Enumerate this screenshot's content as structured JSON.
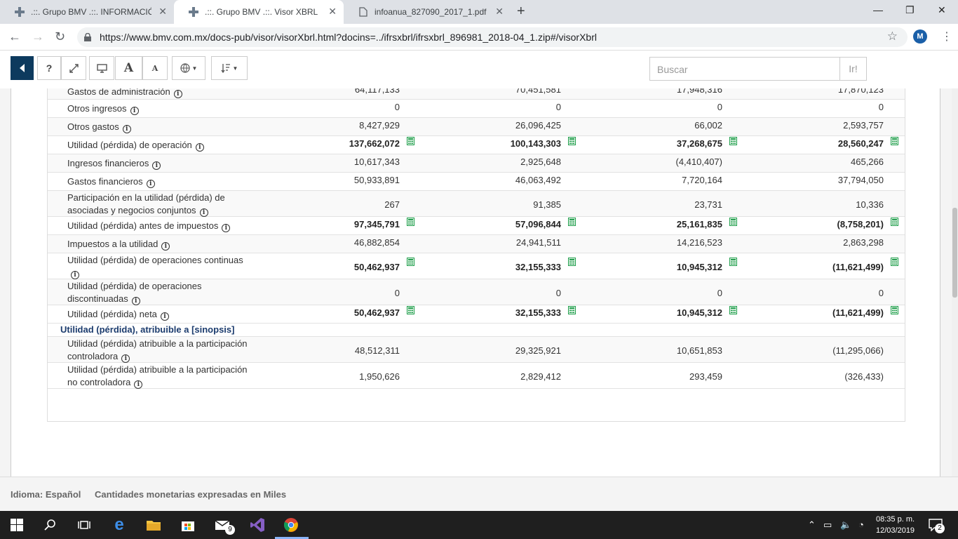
{
  "browser": {
    "tabs": [
      {
        "label": ".::. Grupo BMV .::. INFORMACIÓN",
        "active": false
      },
      {
        "label": ".::. Grupo BMV .::. Visor XBRL",
        "active": true
      },
      {
        "label": "infoanua_827090_2017_1.pdf",
        "active": false
      }
    ],
    "url": "https://www.bmv.com.mx/docs-pub/visor/visorXbrl.html?docins=../ifrsxbrl/ifrsxbrl_896981_2018-04_1.zip#/visorXbrl",
    "profile_initial": "M"
  },
  "toolbar": {
    "help_label": "?",
    "font_large_label": "A",
    "font_small_label": "A",
    "search_placeholder": "Buscar",
    "go_label": "Ir!"
  },
  "table": {
    "rows": [
      {
        "label": "Gastos de administración",
        "values": [
          "64,117,133",
          "70,451,581",
          "17,948,316",
          "17,870,123"
        ],
        "bold": false,
        "calc": false
      },
      {
        "label": "Otros ingresos",
        "values": [
          "0",
          "0",
          "0",
          "0"
        ],
        "bold": false,
        "calc": false
      },
      {
        "label": "Otros gastos",
        "values": [
          "8,427,929",
          "26,096,425",
          "66,002",
          "2,593,757"
        ],
        "bold": false,
        "calc": false
      },
      {
        "label": "Utilidad (pérdida) de operación",
        "values": [
          "137,662,072",
          "100,143,303",
          "37,268,675",
          "28,560,247"
        ],
        "bold": true,
        "calc": true
      },
      {
        "label": "Ingresos financieros",
        "values": [
          "10,617,343",
          "2,925,648",
          "(4,410,407)",
          "465,266"
        ],
        "bold": false,
        "calc": false
      },
      {
        "label": "Gastos financieros",
        "values": [
          "50,933,891",
          "46,063,492",
          "7,720,164",
          "37,794,050"
        ],
        "bold": false,
        "calc": false
      },
      {
        "label": "Participación en la utilidad (pérdida) de asociadas y negocios conjuntos",
        "values": [
          "267",
          "91,385",
          "23,731",
          "10,336"
        ],
        "bold": false,
        "calc": false
      },
      {
        "label": "Utilidad (pérdida) antes de impuestos",
        "values": [
          "97,345,791",
          "57,096,844",
          "25,161,835",
          "(8,758,201)"
        ],
        "bold": true,
        "calc": true
      },
      {
        "label": "Impuestos a la utilidad",
        "values": [
          "46,882,854",
          "24,941,511",
          "14,216,523",
          "2,863,298"
        ],
        "bold": false,
        "calc": false
      },
      {
        "label": "Utilidad (pérdida) de operaciones continuas",
        "values": [
          "50,462,937",
          "32,155,333",
          "10,945,312",
          "(11,621,499)"
        ],
        "bold": true,
        "calc": true
      },
      {
        "label": "Utilidad (pérdida) de operaciones discontinuadas",
        "values": [
          "0",
          "0",
          "0",
          "0"
        ],
        "bold": false,
        "calc": false
      },
      {
        "label": "Utilidad (pérdida) neta",
        "values": [
          "50,462,937",
          "32,155,333",
          "10,945,312",
          "(11,621,499)"
        ],
        "bold": true,
        "calc": true
      },
      {
        "label": "Utilidad (pérdida) atribuible a la participación controladora",
        "values": [
          "48,512,311",
          "29,325,921",
          "10,651,853",
          "(11,295,066)"
        ],
        "bold": false,
        "calc": false
      },
      {
        "label": "Utilidad (pérdida) atribuible a la participación no controladora",
        "values": [
          "1,950,626",
          "2,829,412",
          "293,459",
          "(326,433)"
        ],
        "bold": false,
        "calc": false
      }
    ],
    "section_title": "Utilidad (pérdida), atribuible a [sinopsis]"
  },
  "footer": {
    "language": "Idioma: Español",
    "units": "Cantidades monetarias expresadas en Miles"
  },
  "taskbar": {
    "mail_badge": "9",
    "time": "08:35 p. m.",
    "date": "12/03/2019",
    "notifications": "2"
  },
  "colors": {
    "accent_dark": "#0d3a5e",
    "section_title": "#1c3c6e",
    "calc_icon": "#1e9e4a"
  }
}
